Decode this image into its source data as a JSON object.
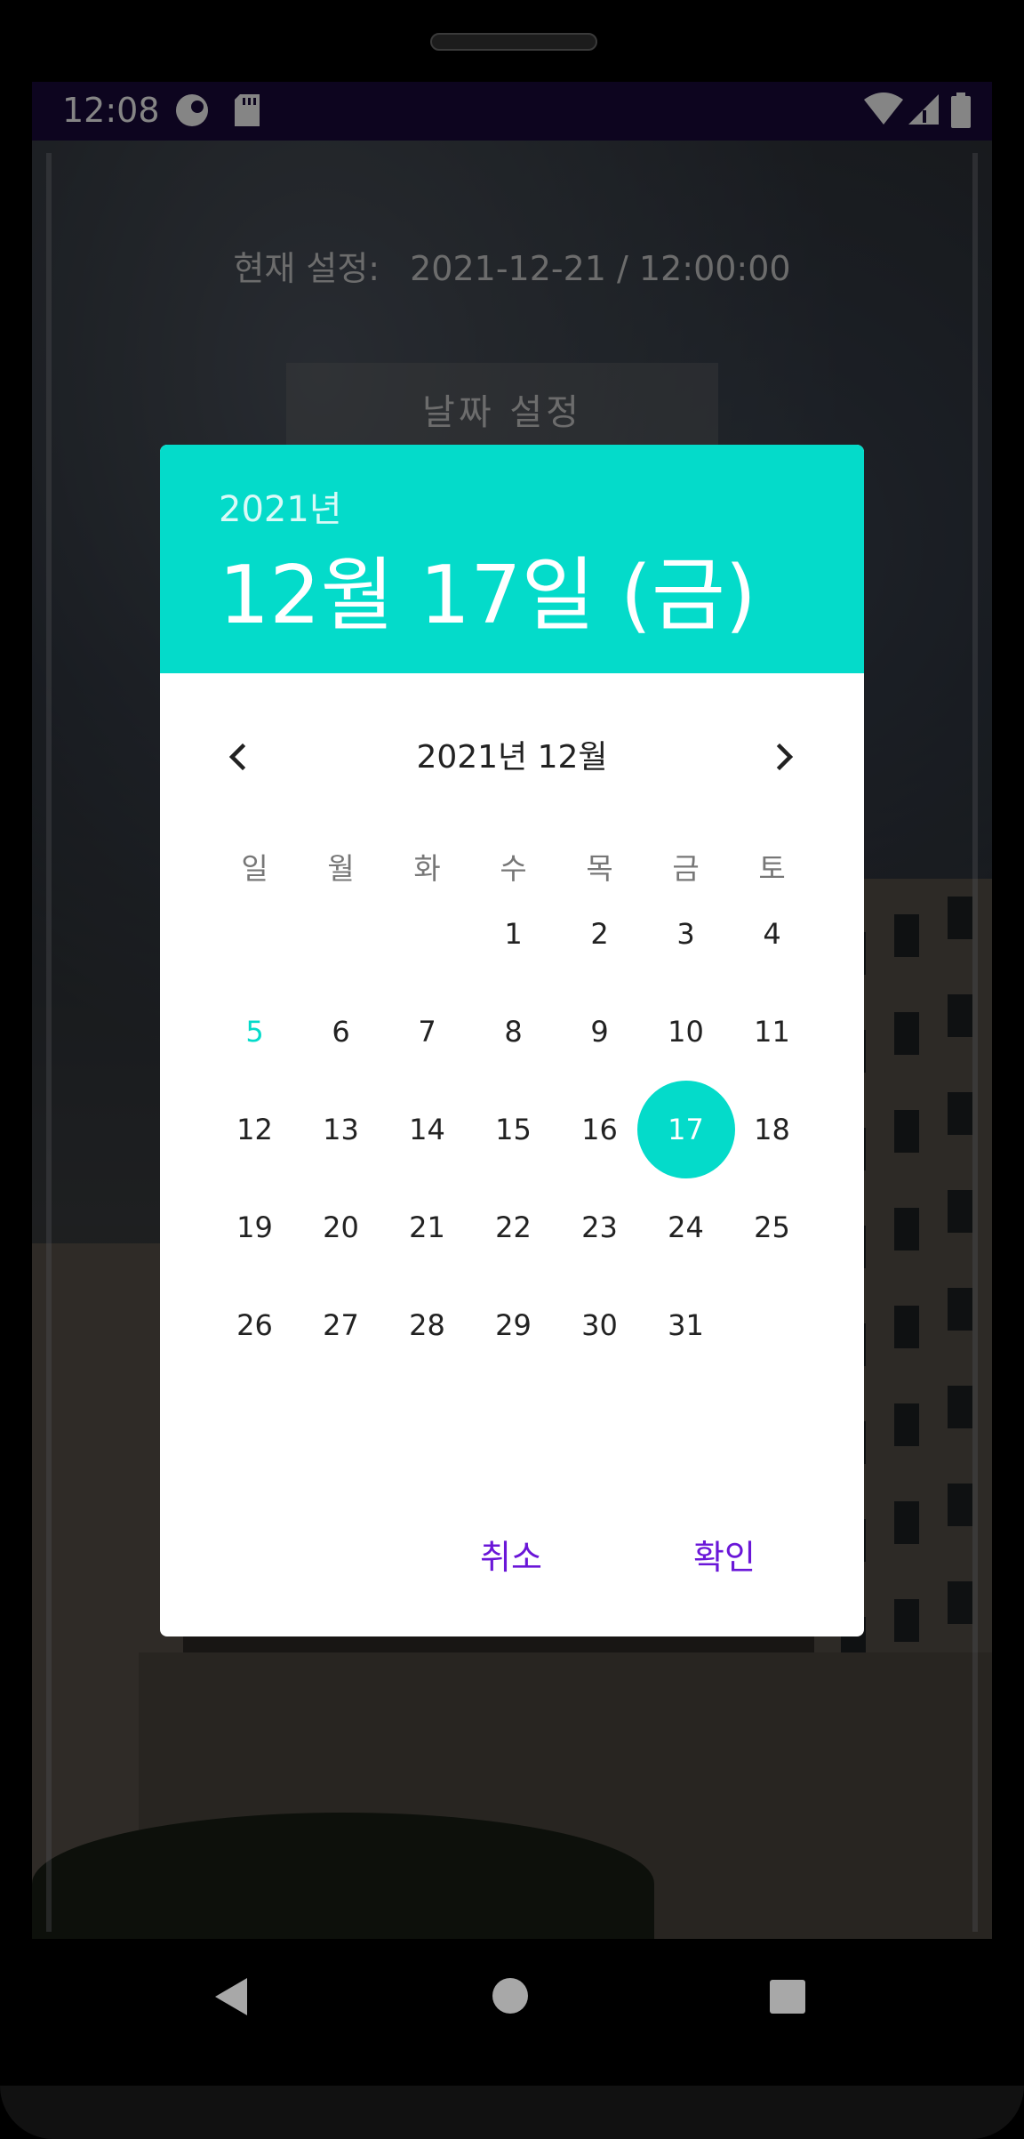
{
  "status_bar": {
    "time": "12:08",
    "icons": [
      "circle-badge-icon",
      "sd-card-icon",
      "wifi-icon",
      "signal-icon",
      "battery-icon"
    ]
  },
  "app": {
    "current_label": "현재 설정:",
    "current_value": "2021-12-21 / 12:00:00",
    "set_date_button": "날짜 설정"
  },
  "dialog": {
    "header_year": "2021년",
    "header_date": "12월 17일 (금)",
    "month_title": "2021년 12월",
    "weekdays": [
      "일",
      "월",
      "화",
      "수",
      "목",
      "금",
      "토"
    ],
    "first_weekday_index": 3,
    "days_in_month": 31,
    "today": 5,
    "selected": 17,
    "cancel_label": "취소",
    "ok_label": "확인",
    "accent_color": "#04dbca",
    "action_color": "#6a16d8"
  },
  "nav_bar": {
    "icons": [
      "back-icon",
      "home-icon",
      "recents-icon"
    ]
  }
}
